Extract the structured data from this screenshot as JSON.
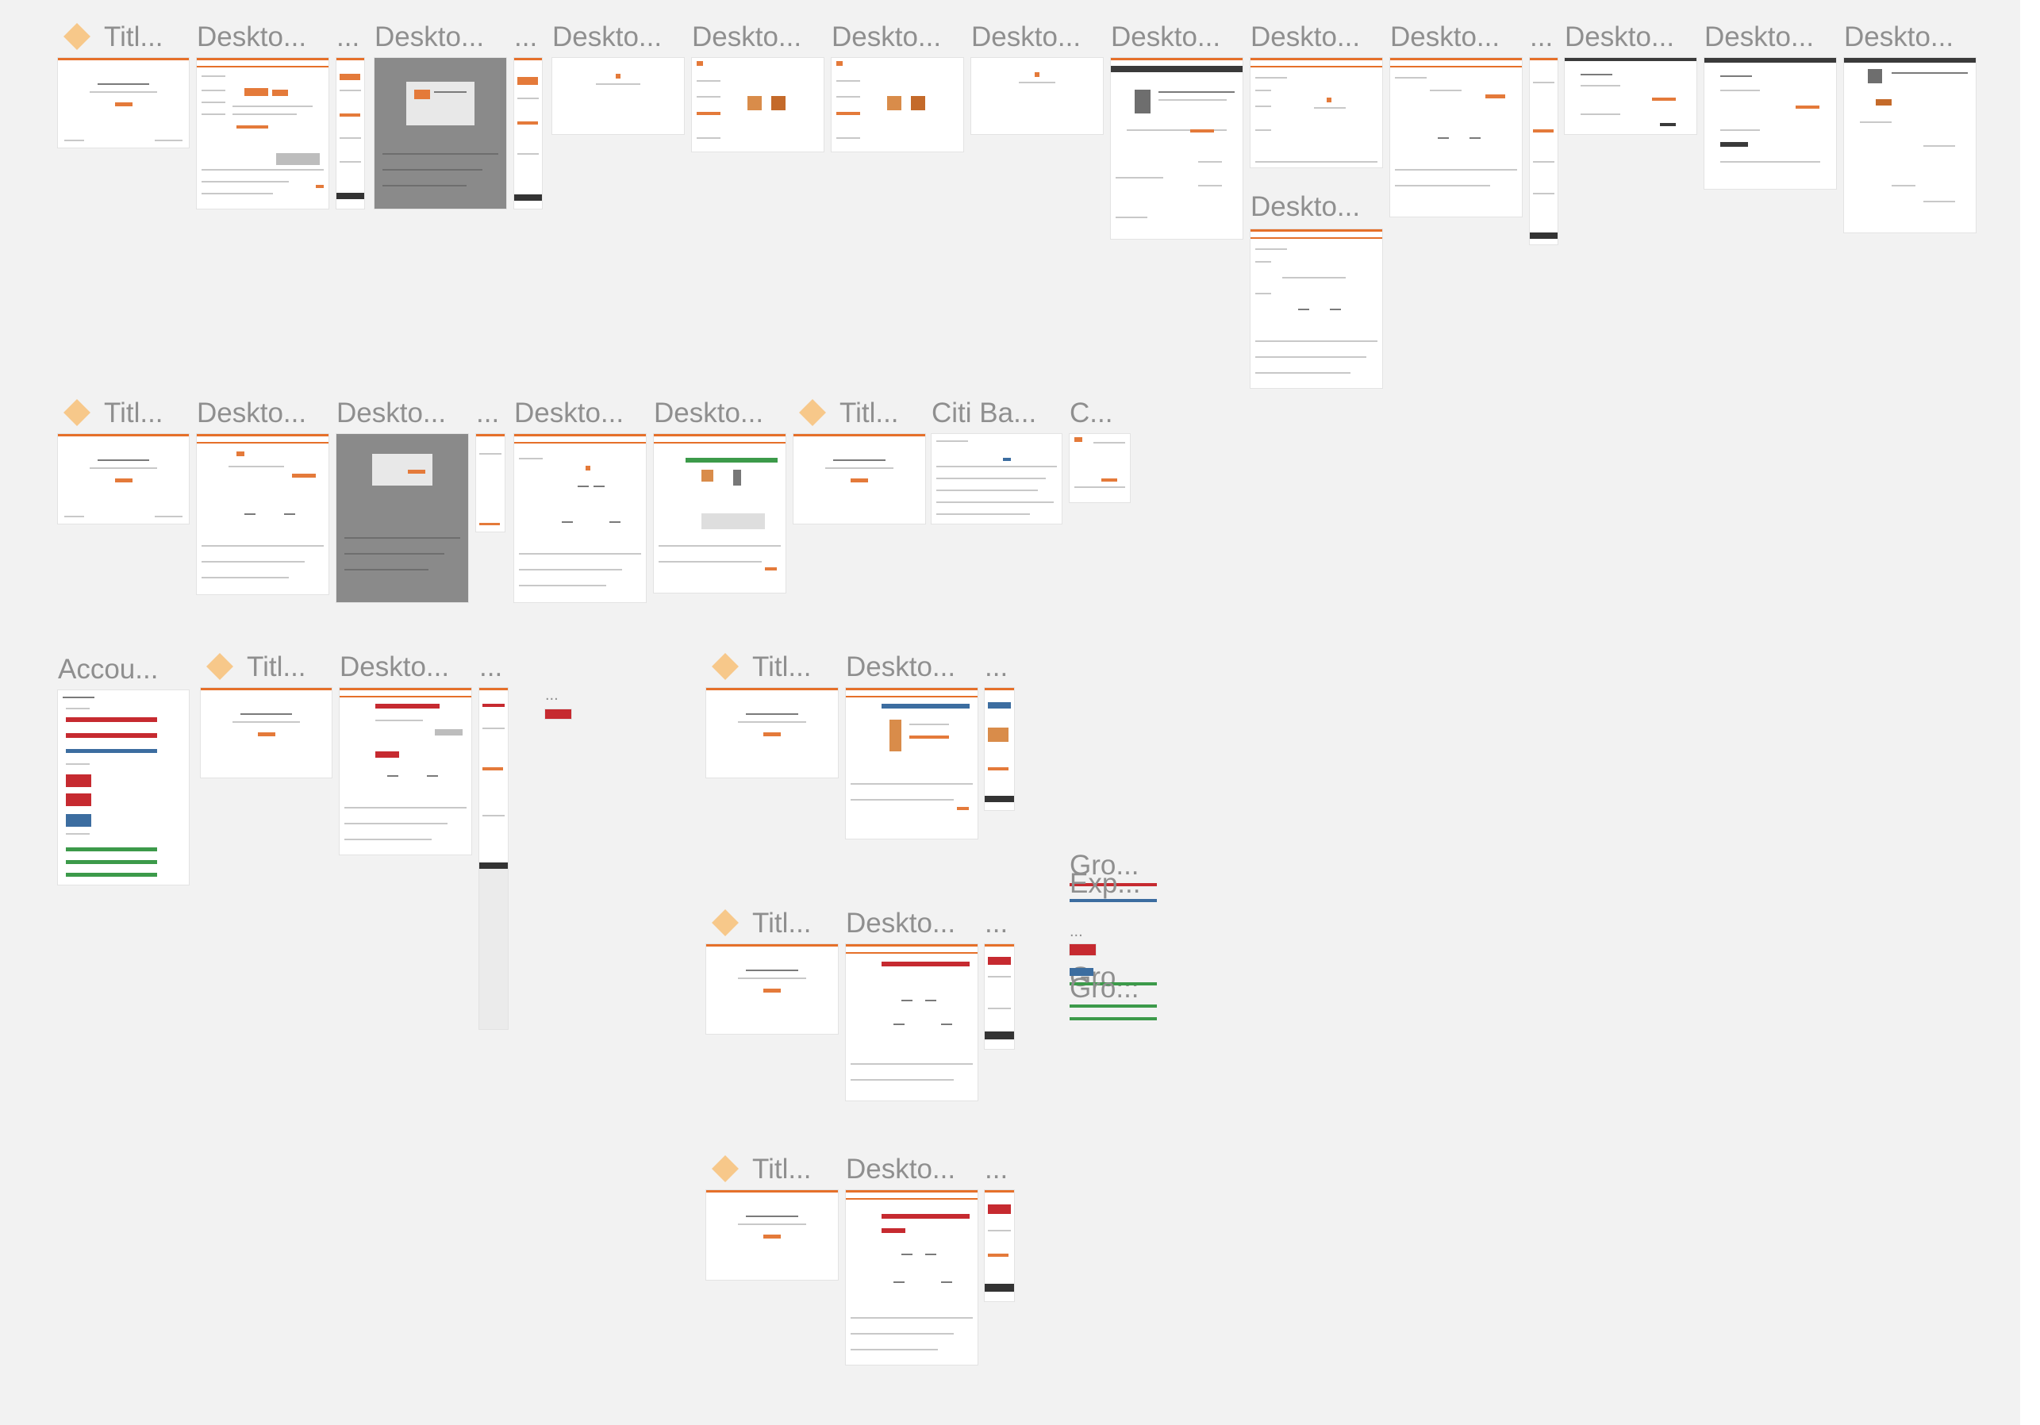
{
  "canvas": {
    "background": "#f2f2f2",
    "accent": "#e5702a"
  },
  "frames": [
    {
      "id": "r1-title",
      "label": "Titl...",
      "type": "title"
    },
    {
      "id": "r1-d1",
      "label": "Deskto...",
      "type": "desktop"
    },
    {
      "id": "r1-e1",
      "label": "...",
      "type": "mobile"
    },
    {
      "id": "r1-d2",
      "label": "Deskto...",
      "type": "desktop-dim"
    },
    {
      "id": "r1-e2",
      "label": "...",
      "type": "mobile"
    },
    {
      "id": "r1-d3",
      "label": "Deskto...",
      "type": "blank"
    },
    {
      "id": "r1-d4",
      "label": "Deskto...",
      "type": "desktop"
    },
    {
      "id": "r1-d5",
      "label": "Deskto...",
      "type": "desktop"
    },
    {
      "id": "r1-d6",
      "label": "Deskto...",
      "type": "blank"
    },
    {
      "id": "r1-d7",
      "label": "Deskto...",
      "type": "desktop"
    },
    {
      "id": "r1-d8",
      "label": "Deskto...",
      "type": "desktop"
    },
    {
      "id": "r1-d8b",
      "label": "Deskto...",
      "type": "desktop"
    },
    {
      "id": "r1-d9",
      "label": "Deskto...",
      "type": "desktop"
    },
    {
      "id": "r1-e3",
      "label": "...",
      "type": "mobile"
    },
    {
      "id": "r1-d10",
      "label": "Deskto...",
      "type": "desktop"
    },
    {
      "id": "r1-d11",
      "label": "Deskto...",
      "type": "desktop"
    },
    {
      "id": "r1-d12",
      "label": "Deskto...",
      "type": "desktop"
    },
    {
      "id": "r2-title",
      "label": "Titl...",
      "type": "title"
    },
    {
      "id": "r2-d1",
      "label": "Deskto...",
      "type": "desktop"
    },
    {
      "id": "r2-d2",
      "label": "Deskto...",
      "type": "desktop-dim"
    },
    {
      "id": "r2-e1",
      "label": "...",
      "type": "mobile"
    },
    {
      "id": "r2-d3",
      "label": "Deskto...",
      "type": "desktop"
    },
    {
      "id": "r2-d4",
      "label": "Deskto...",
      "type": "desktop"
    },
    {
      "id": "r2-title2",
      "label": "Titl...",
      "type": "title"
    },
    {
      "id": "r2-citi",
      "label": "Citi Ba...",
      "type": "desktop"
    },
    {
      "id": "r2-c",
      "label": "C...",
      "type": "desktop"
    },
    {
      "id": "r3-acc",
      "label": "Accou...",
      "type": "accounts"
    },
    {
      "id": "r3-title",
      "label": "Titl...",
      "type": "title"
    },
    {
      "id": "r3-d1",
      "label": "Deskto...",
      "type": "desktop"
    },
    {
      "id": "r3-e1",
      "label": "...",
      "type": "mobile"
    },
    {
      "id": "r3-e2",
      "label": "...",
      "type": "red-chip"
    },
    {
      "id": "r3-title2",
      "label": "Titl...",
      "type": "title"
    },
    {
      "id": "r3-d2",
      "label": "Deskto...",
      "type": "desktop"
    },
    {
      "id": "r3-e3",
      "label": "...",
      "type": "mobile"
    },
    {
      "id": "g-gro1",
      "label": "Gro...",
      "type": "group"
    },
    {
      "id": "g-exp",
      "label": "Exp...",
      "type": "group"
    },
    {
      "id": "r4-title",
      "label": "Titl...",
      "type": "title"
    },
    {
      "id": "r4-d1",
      "label": "Deskto...",
      "type": "desktop"
    },
    {
      "id": "r4-e1",
      "label": "...",
      "type": "mobile"
    },
    {
      "id": "r4-e2",
      "label": "...",
      "type": "red-chip"
    },
    {
      "id": "g-gro2",
      "label": "Gro...",
      "type": "group"
    },
    {
      "id": "g-gro3",
      "label": "Gro...",
      "type": "group"
    },
    {
      "id": "r5-title",
      "label": "Titl...",
      "type": "title"
    },
    {
      "id": "r5-d1",
      "label": "Deskto...",
      "type": "desktop"
    },
    {
      "id": "r5-e1",
      "label": "...",
      "type": "mobile"
    }
  ]
}
